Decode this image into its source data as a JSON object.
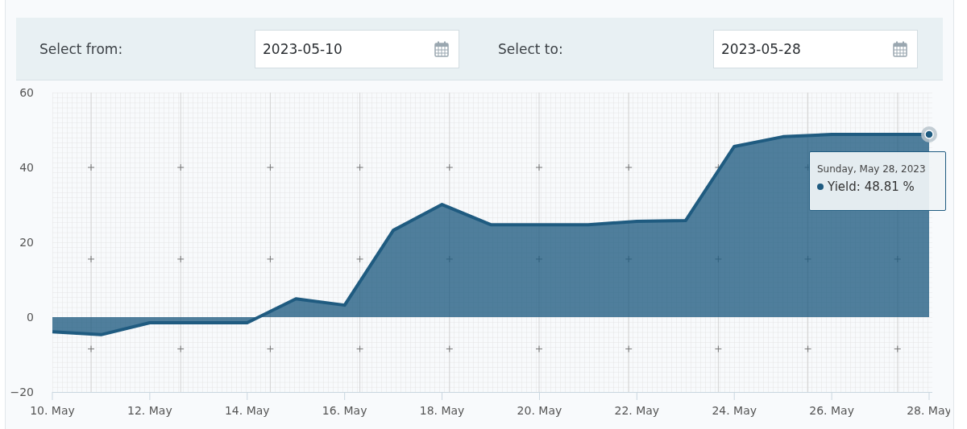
{
  "filter": {
    "from": {
      "label": "Select from:",
      "value": "2023-05-10"
    },
    "to": {
      "label": "Select to:",
      "value": "2023-05-28"
    }
  },
  "chart": {
    "chart_data": {
      "type": "area",
      "categories": [
        "10. May",
        null,
        "12. May",
        null,
        "14. May",
        null,
        "16. May",
        null,
        "18. May",
        null,
        "20. May",
        null,
        "22. May",
        null,
        "24. May",
        null,
        "26. May",
        null,
        "28. May"
      ],
      "series": [
        {
          "name": "Yield",
          "color": "#1f5b80",
          "values": [
            -3.9,
            -4.7,
            -1.5,
            -1.5,
            -1.5,
            4.9,
            3.2,
            23.2,
            30.1,
            24.7,
            24.7,
            24.7,
            25.6,
            25.8,
            45.6,
            48.2,
            48.8,
            48.81,
            48.81
          ]
        }
      ],
      "ylim": [
        -20,
        60
      ],
      "yticks": [
        -20,
        0,
        20,
        40,
        60
      ]
    },
    "tooltip": {
      "date": "Sunday, May 28, 2023",
      "separator": ":",
      "value": "48.81 %"
    }
  }
}
